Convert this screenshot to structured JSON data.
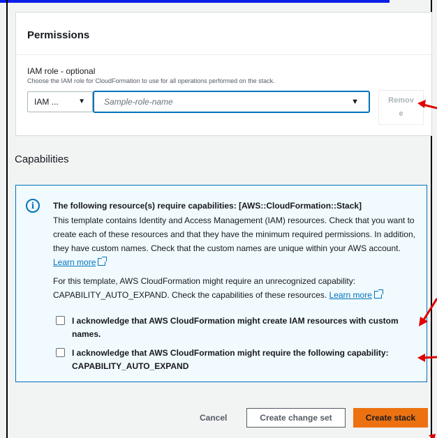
{
  "permissions": {
    "title": "Permissions",
    "iam_role_label": "IAM role - optional",
    "iam_role_description": "Choose the IAM role for CloudFormation to use for all operations performed on the stack.",
    "type_select_value": "IAM ...",
    "role_placeholder": "Sample-role-name",
    "remove_label_line1": "Remov",
    "remove_label_line2": "e"
  },
  "capabilities": {
    "title": "Capabilities",
    "info_heading": "The following resource(s) require capabilities: [AWS::CloudFormation::Stack]",
    "para1": "This template contains Identity and Access Management (IAM) resources. Check that you want to create each of these resources and that they have the minimum required permissions. In addition, they have custom names. Check that the custom names are unique within your AWS account.",
    "para1_link": "Learn more",
    "para2": "For this template, AWS CloudFormation might require an unrecognized capability: CAPABILITY_AUTO_EXPAND. Check the capabilities of these resources.",
    "para2_link": "Learn more",
    "ack1": "I acknowledge that AWS CloudFormation might create IAM resources with custom names.",
    "ack2": "I acknowledge that AWS CloudFormation might require the following capability: CAPABILITY_AUTO_EXPAND"
  },
  "footer": {
    "cancel_label": "Cancel",
    "change_set_label": "Create change set",
    "create_label": "Create stack"
  },
  "colors": {
    "primary": "#ec7211",
    "link": "#0073bb",
    "info_bg": "#f1faff",
    "annotation": "#e00000"
  }
}
